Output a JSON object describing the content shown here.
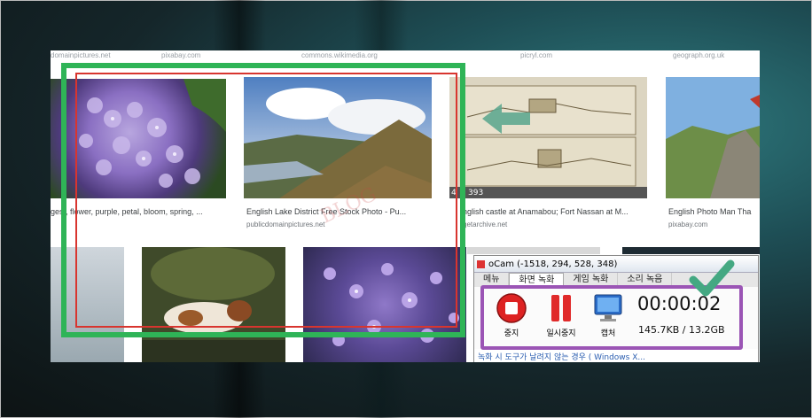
{
  "sources_row": [
    "domainpictures.net",
    "pixabay.com",
    "commons.wikimedia.org",
    "picryl.com",
    "geograph.org.uk"
  ],
  "results": [
    {
      "caption": "gest, flower, purple, petal, bloom, spring, ...",
      "source": ""
    },
    {
      "caption": "English Lake District Free Stock Photo - Pu...",
      "source": "publicdomainpictures.net"
    },
    {
      "caption": "nglish castle at Anamabou; Fort Nassan at M...",
      "source": "getarchive.net",
      "dims": "4 × 393"
    },
    {
      "caption": "English Photo Man Tha",
      "source": "pixabay.com"
    }
  ],
  "watermark": "BLOG",
  "ocam": {
    "title": "oCam (-1518, 294, 528, 348)",
    "tabs": [
      "메뉴",
      "화면 녹화",
      "게임 녹화",
      "소리 녹음"
    ],
    "buttons": {
      "stop": "중지",
      "pause": "일시중지",
      "capture": "캡처"
    },
    "timer": "00:00:02",
    "size": "145.7KB / 13.2GB"
  },
  "bottom_link": "녹화 시 도구가 날려지 않는 경우 ( Windows X...",
  "colors": {
    "green_frame": "#2fb457",
    "red_frame": "#d8352f",
    "purple_frame": "#9b55b5",
    "arrow": "#5fa890",
    "check": "#44a882"
  }
}
